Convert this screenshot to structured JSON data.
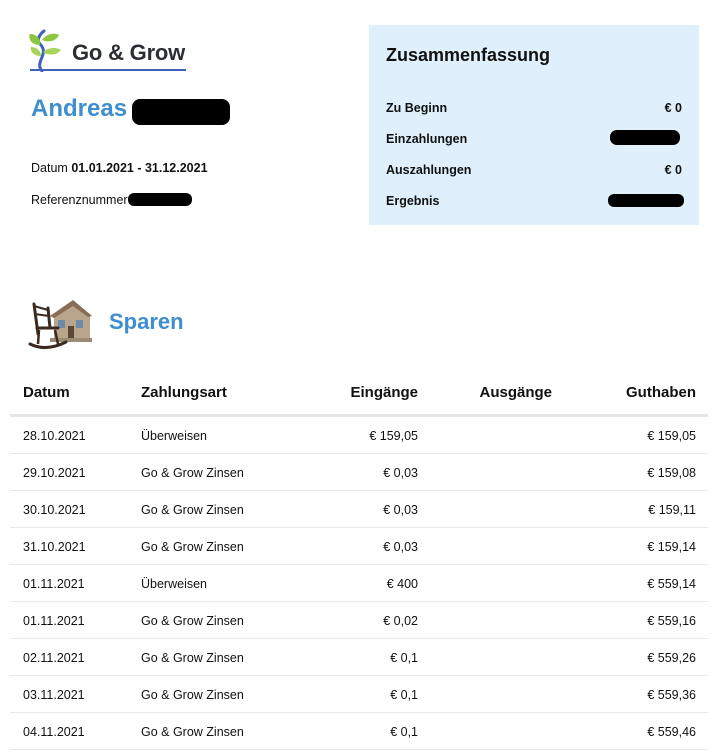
{
  "brand": {
    "name": "Go & Grow",
    "accent": "#3e8ed0",
    "underline": "#3f62b8"
  },
  "customer": {
    "first_name": "Andreas"
  },
  "meta": {
    "date_label": "Datum",
    "date_range": "01.01.2021 - 31.12.2021",
    "reference_label": "Referenznummer"
  },
  "summary": {
    "title": "Zusammenfassung",
    "background": "#dff0fc",
    "rows": [
      {
        "label": "Zu Beginn",
        "value": "€ 0"
      },
      {
        "label": "Einzahlungen",
        "value": ""
      },
      {
        "label": "Auszahlungen",
        "value": "€ 0"
      },
      {
        "label": "Ergebnis",
        "value": ""
      }
    ]
  },
  "section": {
    "title": "Sparen",
    "icon": "rocking-chair-house-icon"
  },
  "table": {
    "columns": [
      "Datum",
      "Zahlungsart",
      "Eingänge",
      "Ausgänge",
      "Guthaben"
    ],
    "rows": [
      {
        "date": "28.10.2021",
        "type": "Überweisen",
        "in": "€ 159,05",
        "out": "",
        "balance": "€ 159,05"
      },
      {
        "date": "29.10.2021",
        "type": "Go & Grow Zinsen",
        "in": "€ 0,03",
        "out": "",
        "balance": "€ 159,08"
      },
      {
        "date": "30.10.2021",
        "type": "Go & Grow Zinsen",
        "in": "€ 0,03",
        "out": "",
        "balance": "€ 159,11"
      },
      {
        "date": "31.10.2021",
        "type": "Go & Grow Zinsen",
        "in": "€ 0,03",
        "out": "",
        "balance": "€ 159,14"
      },
      {
        "date": "01.11.2021",
        "type": "Überweisen",
        "in": "€ 400",
        "out": "",
        "balance": "€ 559,14"
      },
      {
        "date": "01.11.2021",
        "type": "Go & Grow Zinsen",
        "in": "€ 0,02",
        "out": "",
        "balance": "€ 559,16"
      },
      {
        "date": "02.11.2021",
        "type": "Go & Grow Zinsen",
        "in": "€ 0,1",
        "out": "",
        "balance": "€ 559,26"
      },
      {
        "date": "03.11.2021",
        "type": "Go & Grow Zinsen",
        "in": "€ 0,1",
        "out": "",
        "balance": "€ 559,36"
      },
      {
        "date": "04.11.2021",
        "type": "Go & Grow Zinsen",
        "in": "€ 0,1",
        "out": "",
        "balance": "€ 559,46"
      }
    ]
  }
}
